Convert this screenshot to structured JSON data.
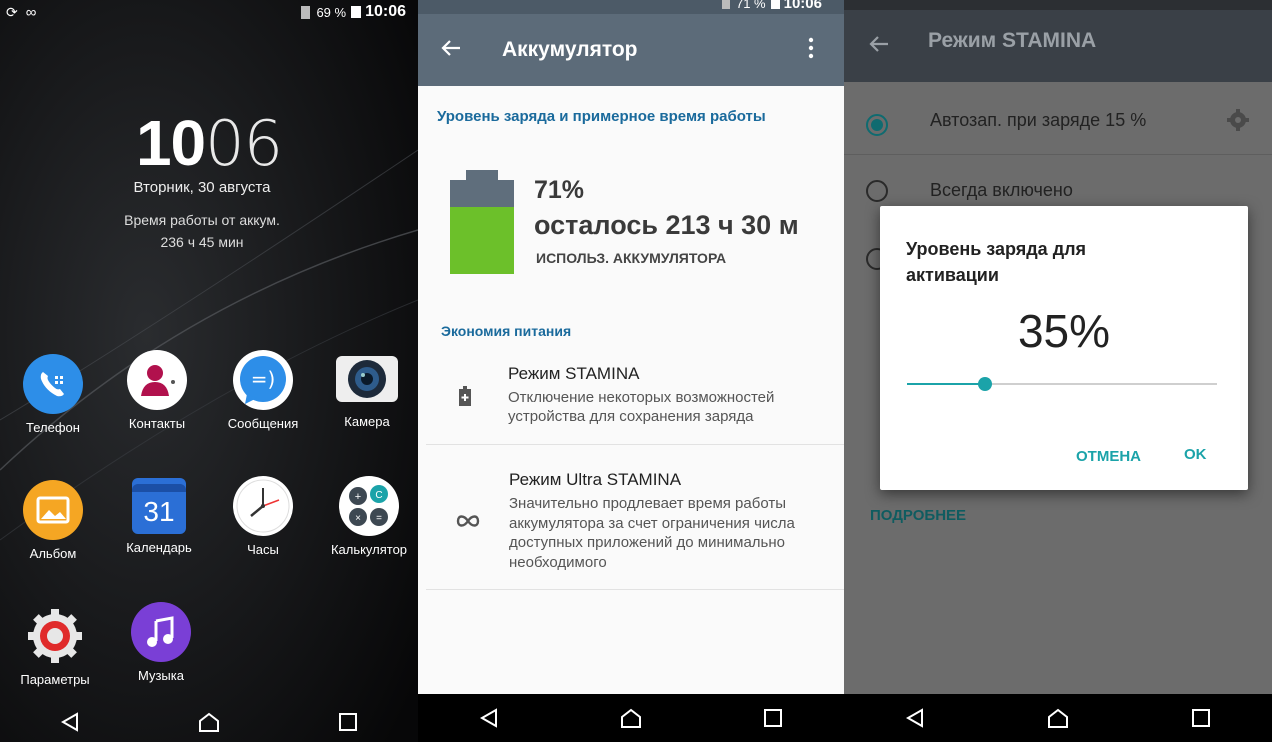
{
  "home": {
    "status": {
      "battery_percent": "69 %",
      "time": "10:06"
    },
    "clock": {
      "hour": "10",
      "minute": "06",
      "date": "Вторник, 30 августа",
      "battery_label": "Время работы от аккум.",
      "battery_time": "236 ч 45 мин"
    },
    "apps": [
      {
        "label": "Телефон",
        "icon": "phone-icon",
        "color": "#2d8ee8"
      },
      {
        "label": "Контакты",
        "icon": "contacts-icon",
        "color": "#ffffff"
      },
      {
        "label": "Сообщения",
        "icon": "messages-icon",
        "color": "#2d8ee8"
      },
      {
        "label": "Камера",
        "icon": "camera-icon",
        "color": "#ffffff"
      },
      {
        "label": "Альбом",
        "icon": "album-icon",
        "color": "#f5a623"
      },
      {
        "label": "Календарь",
        "icon": "calendar-icon",
        "color": "#2b6fd6",
        "day": "31"
      },
      {
        "label": "Часы",
        "icon": "clock-icon",
        "color": "#ffffff"
      },
      {
        "label": "Калькулятор",
        "icon": "calculator-icon",
        "color": "#3d4852"
      },
      {
        "label": "Параметры",
        "icon": "settings-icon",
        "color": "#e02b2b"
      },
      {
        "label": "Музыка",
        "icon": "music-icon",
        "color": "#7a3fd6"
      }
    ]
  },
  "battery": {
    "status": {
      "battery_percent": "71 %",
      "time": "10:06"
    },
    "title": "Аккумулятор",
    "section_level": "Уровень заряда и примерное время работы",
    "level_percent": "71%",
    "level_fraction": 0.71,
    "remaining": "осталось 213 ч 30 м",
    "usage_link": "ИСПОЛЬЗ. АККУМУЛЯТОРА",
    "section_saving": "Экономия питания",
    "items": [
      {
        "title": "Режим STAMINA",
        "desc": "Отключение некоторых возможностей устройства для сохранения заряда"
      },
      {
        "title": "Режим Ultra STAMINA",
        "desc": "Значительно продлевает время работы аккумулятора за счет ограничения числа доступных приложений до минимально необходимого"
      }
    ]
  },
  "stamina": {
    "title": "Режим STAMINA",
    "options": [
      {
        "label": "Автозап. при заряде 15 %",
        "selected": true
      },
      {
        "label": "Всегда включено",
        "selected": false
      }
    ],
    "more_link": "ПОДРОБНЕЕ",
    "dialog": {
      "title": "Уровень заряда для активации",
      "value": "35%",
      "slider_fraction": 0.25,
      "cancel": "ОТМЕНА",
      "ok": "OK"
    }
  },
  "colors": {
    "accent_teal": "#1ba3a9",
    "battery_green": "#6cc02a",
    "header_blue": "#1a6a9c"
  }
}
